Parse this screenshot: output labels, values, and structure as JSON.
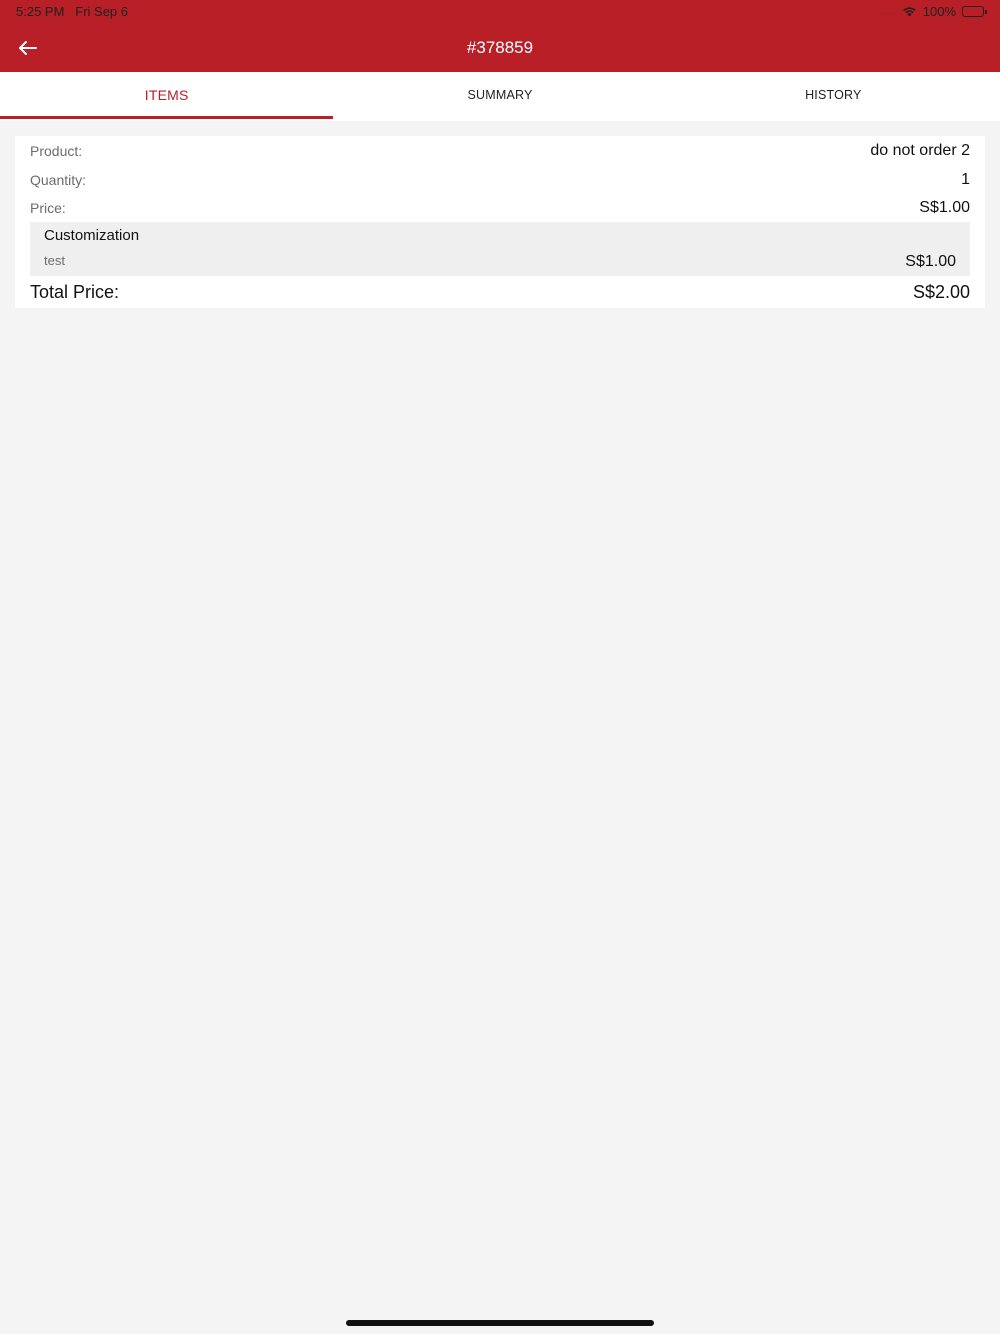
{
  "status_bar": {
    "time": "5:25 PM",
    "date": "Fri Sep 6",
    "battery": "100%",
    "signal_dots": "....",
    "icons": [
      "wifi-icon",
      "battery-icon"
    ]
  },
  "header": {
    "title": "#378859",
    "back_icon": "arrow-left-icon",
    "color": "#b81f27"
  },
  "tabs": [
    {
      "label": "ITEMS",
      "active": true
    },
    {
      "label": "SUMMARY",
      "active": false
    },
    {
      "label": "HISTORY",
      "active": false
    }
  ],
  "item": {
    "product_label": "Product:",
    "product_value": "do not order 2",
    "quantity_label": "Quantity:",
    "quantity_value": "1",
    "price_label": "Price:",
    "price_value": "S$1.00",
    "customization": {
      "title": "Customization",
      "name": "test",
      "price": "S$1.00"
    },
    "total_label": "Total Price:",
    "total_value": "S$2.00"
  }
}
